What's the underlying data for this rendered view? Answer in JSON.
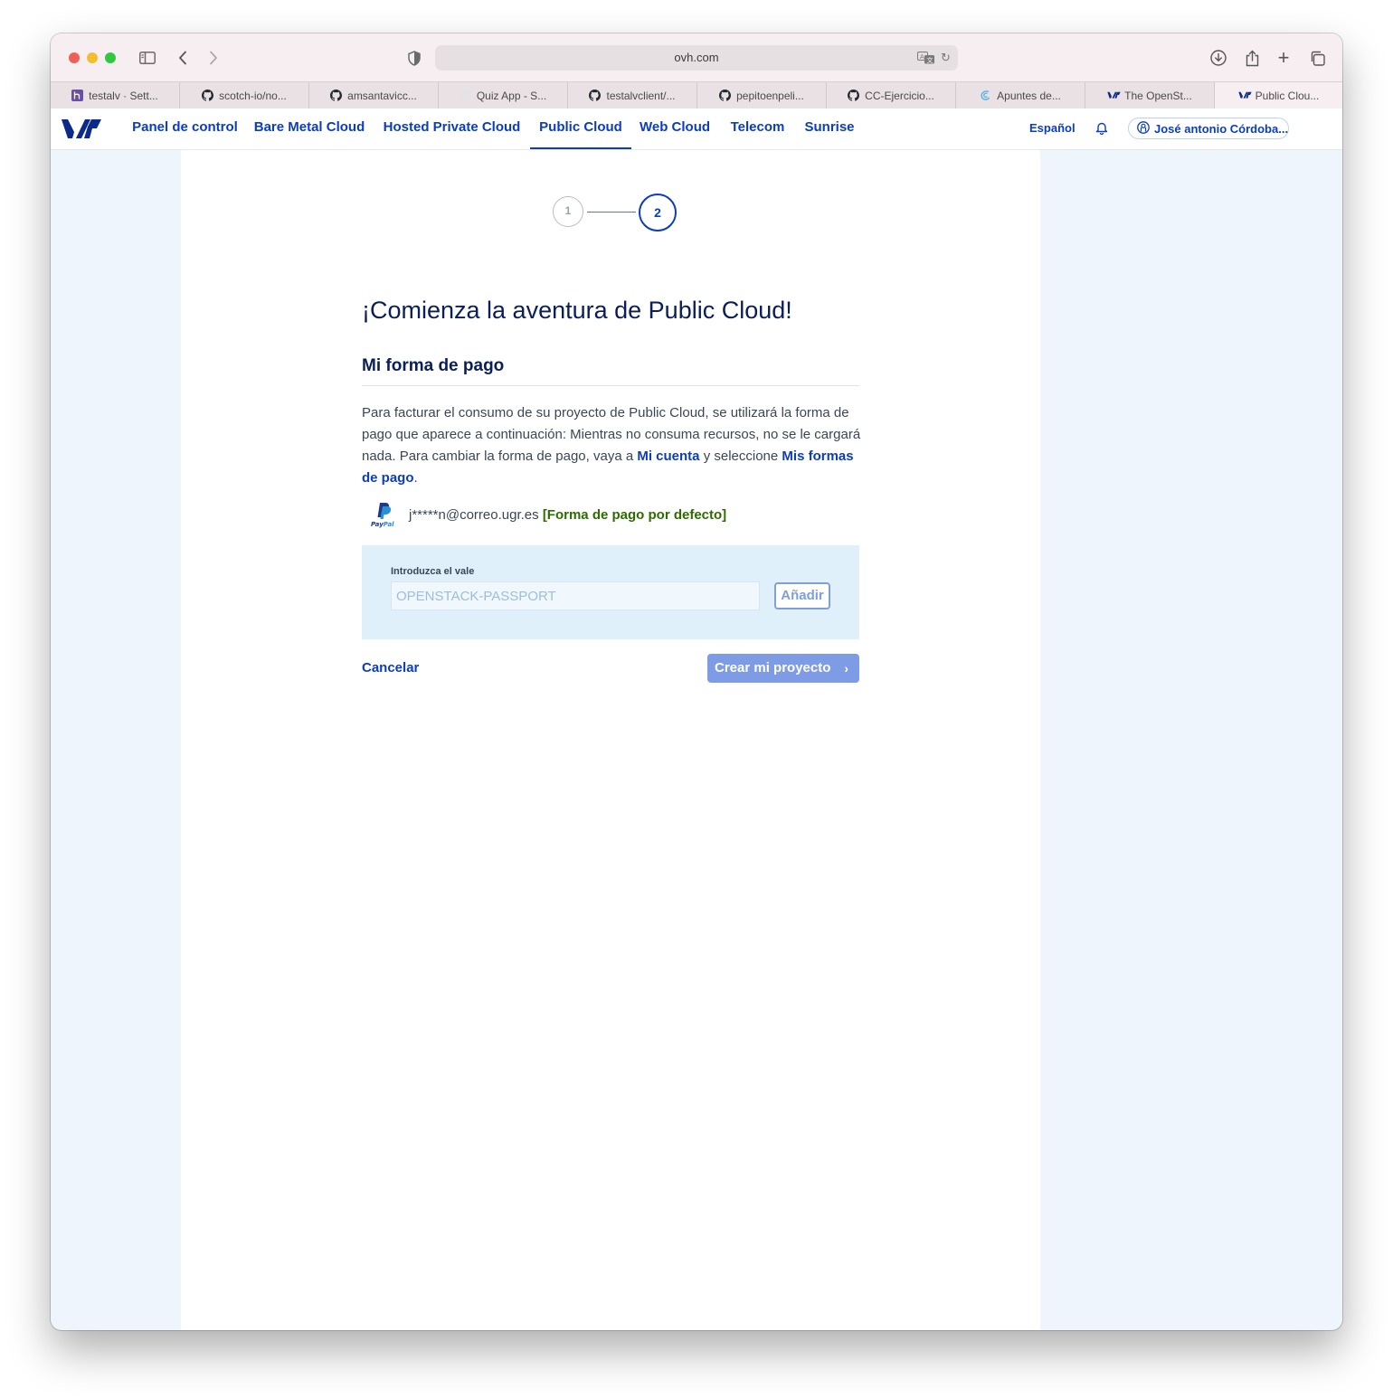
{
  "browser": {
    "url": "ovh.com",
    "tabs": [
      {
        "title": "testalv · Sett...",
        "icon": "heroku-icon"
      },
      {
        "title": "scotch-io/no...",
        "icon": "github-icon"
      },
      {
        "title": "amsantavicc...",
        "icon": "github-icon"
      },
      {
        "title": "Quiz App - S...",
        "icon": "generic-page-icon"
      },
      {
        "title": "testalvclient/...",
        "icon": "github-icon"
      },
      {
        "title": "pepitoenpeli...",
        "icon": "github-icon"
      },
      {
        "title": "CC-Ejercicio...",
        "icon": "github-icon"
      },
      {
        "title": "Apuntes de...",
        "icon": "swirl-icon"
      },
      {
        "title": "The OpenSt...",
        "icon": "ovh-icon"
      },
      {
        "title": "Public Clou...",
        "icon": "ovh-icon",
        "active": true
      }
    ]
  },
  "nav": {
    "items": [
      {
        "label": "Panel de control"
      },
      {
        "label": "Bare Metal Cloud"
      },
      {
        "label": "Hosted Private Cloud"
      },
      {
        "label": "Public Cloud",
        "active": true
      },
      {
        "label": "Web Cloud"
      },
      {
        "label": "Telecom"
      },
      {
        "label": "Sunrise"
      }
    ],
    "language": "Español",
    "user": "José antonio Córdoba..."
  },
  "stepper": {
    "step1": "1",
    "step2": "2",
    "current": 2
  },
  "main": {
    "title": "¡Comienza la aventura de Public Cloud!",
    "section_title": "Mi forma de pago",
    "description_part1": "Para facturar el consumo de su proyecto de Public Cloud, se utilizará la forma de pago que aparece a continuación: Mientras no consuma recursos, no se le cargará nada. Para cambiar la forma de pago, vaya a ",
    "link_account": "Mi cuenta",
    "description_part2": " y seleccione ",
    "link_payment_methods": "Mis formas de pago",
    "description_part3": ".",
    "payment_email": "j*****n@correo.ugr.es",
    "payment_default": "[Forma de pago por defecto]",
    "paypal_label": "PayPal",
    "voucher_label": "Introduzca el vale",
    "voucher_placeholder": "OPENSTACK-PASSPORT",
    "add_button": "Añadir",
    "cancel": "Cancelar",
    "create_button": "Crear mi proyecto"
  },
  "colors": {
    "brand": "#0b3dbd",
    "heading": "#0a1e5a",
    "default_badge": "#2e6b00",
    "voucher_bg": "#dff0fb",
    "create_disabled": "#7e9be6"
  }
}
